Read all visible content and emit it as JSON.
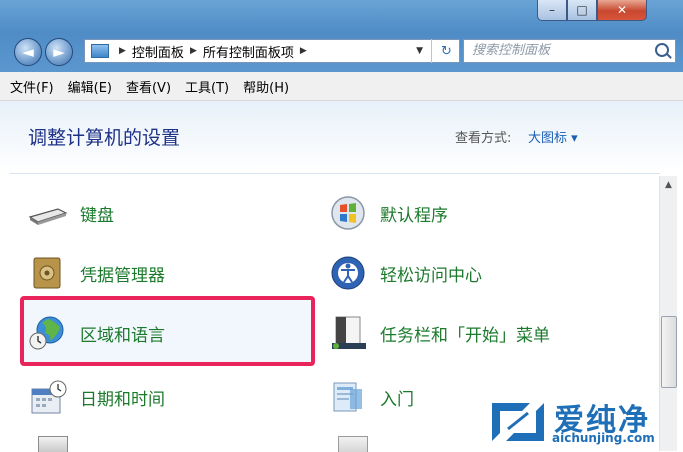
{
  "window": {
    "minimize": "–",
    "maximize": "□",
    "close": "✕"
  },
  "nav": {
    "back": "◄",
    "forward": "►"
  },
  "address": {
    "crumbs": [
      "控制面板",
      "所有控制面板项"
    ]
  },
  "search": {
    "placeholder": "搜索控制面板"
  },
  "menu": [
    "文件(F)",
    "编辑(E)",
    "查看(V)",
    "工具(T)",
    "帮助(H)"
  ],
  "page": {
    "title": "调整计算机的设置",
    "view_label": "查看方式:",
    "view_value": "大图标 ▾"
  },
  "items": [
    {
      "label": "键盘",
      "icon": "keyboard-icon"
    },
    {
      "label": "默认程序",
      "icon": "windows-flag-icon"
    },
    {
      "label": "凭据管理器",
      "icon": "vault-icon"
    },
    {
      "label": "轻松访问中心",
      "icon": "accessibility-icon"
    },
    {
      "label": "区域和语言",
      "icon": "globe-clock-icon"
    },
    {
      "label": "任务栏和「开始」菜单",
      "icon": "taskbar-icon"
    },
    {
      "label": "日期和时间",
      "icon": "calendar-clock-icon"
    },
    {
      "label": "入门",
      "icon": "getting-started-icon"
    }
  ],
  "watermark": {
    "brand": "爱纯净",
    "url": "aichunjing.com"
  },
  "colors": {
    "link_green": "#1c7a2c",
    "highlight": "#e8245a",
    "heading": "#1e3287",
    "watermark": "#1f6fb8"
  }
}
